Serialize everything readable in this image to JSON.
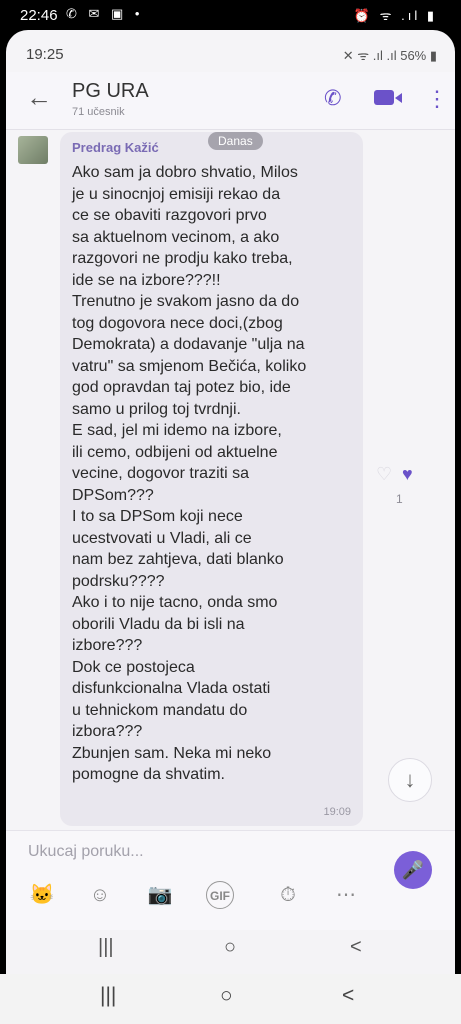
{
  "outer_status": {
    "time": "22:46",
    "icons_left": "✆ ✉ ▣ •",
    "icons_right": "⏰ ᯤ .ıl ▮"
  },
  "inner_status": {
    "time": "19:25",
    "icons": "✕ ᯤ .ıl .ıl 56% ▮"
  },
  "header": {
    "back_icon": "←",
    "title": "PG URA",
    "subtitle": "71 učesnik",
    "call_icon": "✆",
    "menu_icon": "⋮"
  },
  "message": {
    "sender": "Predrag Kažić",
    "date_pill": "Danas",
    "text": "Ako sam ja dobro shvatio, Milos\nje u sinocnjoj emisiji rekao da\nce se obaviti razgovori prvo\nsa aktuelnom vecinom, a ako\nrazgovori ne prodju kako treba,\nide se na izbore???!!\nTrenutno je svakom jasno da do\ntog dogovora nece doci,(zbog\nDemokrata) a dodavanje \"ulja na\nvatru\" sa smjenom Bečića, koliko\ngod opravdan taj potez bio, ide\nsamo u prilog toj tvrdnji.\nE sad, jel mi idemo na izbore,\nili cemo, odbijeni od aktuelne\nvecine, dogovor traziti sa\nDPSom???\nI to sa DPSom koji nece\nucestvovati u Vladi, ali ce\nnam bez zahtjeva, dati blanko\npodrsku????\nAko i to nije tacno, onda smo\noborili Vladu da bi isli na\nizbore???\nDok ce postojeca\ndisfunkcionalna Vlada ostati\nu tehnickom mandatu do\nizbora???\nZbunjen sam. Neka mi neko\npomogne da shvatim.",
    "time": "19:09",
    "reaction_count": "1",
    "heart_empty": "♡",
    "heart_full": "♥"
  },
  "scroll_down_icon": "↓",
  "compose": {
    "placeholder": "Ukucaj poruku...",
    "mic_icon": "🎤",
    "tools": [
      "🐱",
      "☺",
      "📷",
      "GIF",
      "⏱",
      "⋯"
    ]
  },
  "inner_nav": {
    "recent": "|||",
    "home": "○",
    "back": "<"
  },
  "outer_nav": {
    "recent": "|||",
    "home": "○",
    "back": "<"
  },
  "colors": {
    "accent": "#6b52c9",
    "bubble": "#e9e7ee",
    "background": "#f5f4f7"
  }
}
